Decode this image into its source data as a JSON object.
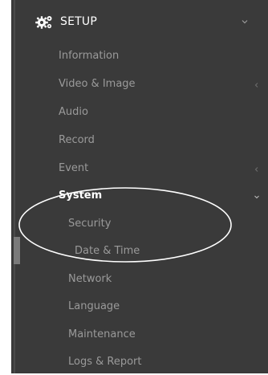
{
  "header": {
    "label": "SETUP",
    "icon": "gears-icon",
    "chevron_icon": "chevron-down-icon"
  },
  "menu": {
    "items": [
      {
        "label": "Information"
      },
      {
        "label": "Video & Image",
        "chevron_icon": "chevron-left-icon"
      },
      {
        "label": "Audio"
      },
      {
        "label": "Record"
      },
      {
        "label": "Event",
        "chevron_icon": "chevron-left-icon"
      },
      {
        "label": "System",
        "chevron_icon": "chevron-down-icon",
        "active": true
      }
    ],
    "system_children": [
      {
        "label": "Security"
      },
      {
        "label": "Date & Time"
      },
      {
        "label": "Network"
      },
      {
        "label": "Language"
      },
      {
        "label": "Maintenance"
      },
      {
        "label": "Logs & Report"
      }
    ]
  },
  "colors": {
    "sidebar_bg": "#3a3a3a",
    "text_muted": "#9a9a9a",
    "text_active": "#ffffff",
    "annotation": "#ffffff"
  }
}
